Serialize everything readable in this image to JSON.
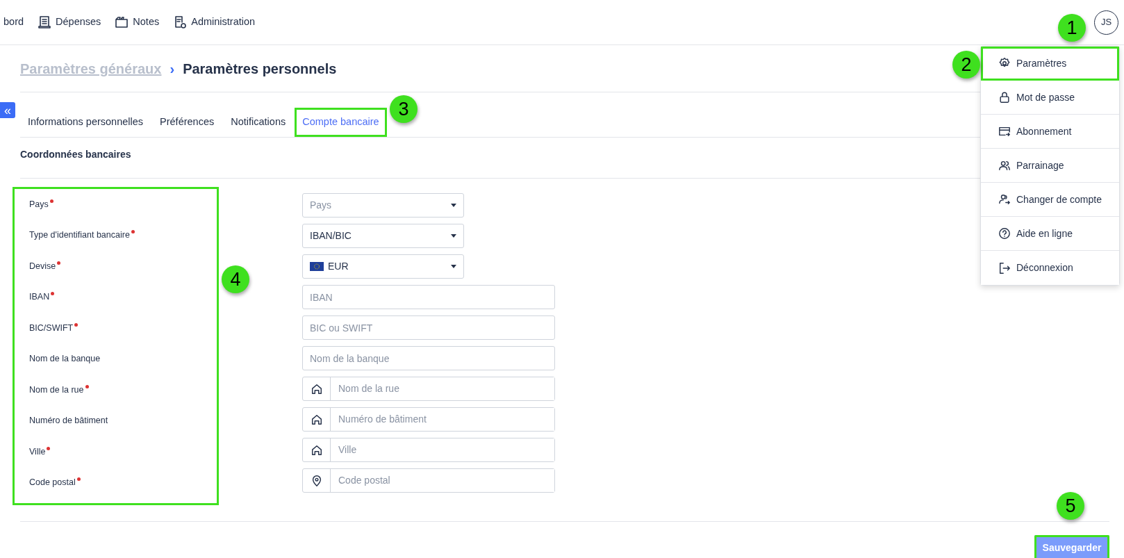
{
  "nav": {
    "items": [
      {
        "label": "bord"
      },
      {
        "label": "Dépenses"
      },
      {
        "label": "Notes"
      },
      {
        "label": "Administration"
      }
    ]
  },
  "avatar": {
    "initials": "JS"
  },
  "user_menu": {
    "items": [
      {
        "label": "Paramètres",
        "highlighted": true
      },
      {
        "label": "Mot de passe",
        "highlighted": false
      },
      {
        "label": "Abonnement",
        "highlighted": false
      },
      {
        "label": "Parrainage",
        "highlighted": false
      },
      {
        "label": "Changer de compte",
        "highlighted": false
      },
      {
        "label": "Aide en ligne",
        "highlighted": false
      },
      {
        "label": "Déconnexion",
        "highlighted": false
      }
    ]
  },
  "breadcrumb": {
    "parent": "Paramètres généraux",
    "separator": "›",
    "current": "Paramètres personnels"
  },
  "sidebar_toggle": {
    "label": "«"
  },
  "tabs": [
    {
      "label": "Informations personnelles",
      "selected": false,
      "highlighted": false
    },
    {
      "label": "Préférences",
      "selected": false,
      "highlighted": false
    },
    {
      "label": "Notifications",
      "selected": false,
      "highlighted": false
    },
    {
      "label": "Compte bancaire",
      "selected": true,
      "highlighted": true
    }
  ],
  "section_title": "Coordonnées bancaires",
  "form": {
    "labels_highlighted": true,
    "fields": [
      {
        "label": "Pays",
        "required": true,
        "kind": "select",
        "placeholder": "Pays"
      },
      {
        "label": "Type d'identifiant bancaire",
        "required": true,
        "kind": "select",
        "value": "IBAN/BIC"
      },
      {
        "label": "Devise",
        "required": true,
        "kind": "currency-select",
        "value": "EUR"
      },
      {
        "label": "IBAN",
        "required": true,
        "kind": "input",
        "placeholder": "IBAN"
      },
      {
        "label": "BIC/SWIFT",
        "required": true,
        "kind": "input",
        "placeholder": "BIC ou SWIFT"
      },
      {
        "label": "Nom de la banque",
        "required": false,
        "kind": "input",
        "placeholder": "Nom de la banque"
      },
      {
        "label": "Nom de la rue",
        "required": true,
        "kind": "address-input",
        "placeholder": "Nom de la rue"
      },
      {
        "label": "Numéro de bâtiment",
        "required": false,
        "kind": "address-input",
        "placeholder": "Numéro de bâtiment"
      },
      {
        "label": "Ville",
        "required": true,
        "kind": "address-input",
        "placeholder": "Ville"
      },
      {
        "label": "Code postal",
        "required": true,
        "kind": "postal-input",
        "placeholder": "Code postal"
      }
    ]
  },
  "save_button": {
    "label": "Sauvegarder",
    "highlighted": true
  },
  "annotations": [
    {
      "number": "1"
    },
    {
      "number": "2"
    },
    {
      "number": "3"
    },
    {
      "number": "4"
    },
    {
      "number": "5"
    }
  ]
}
